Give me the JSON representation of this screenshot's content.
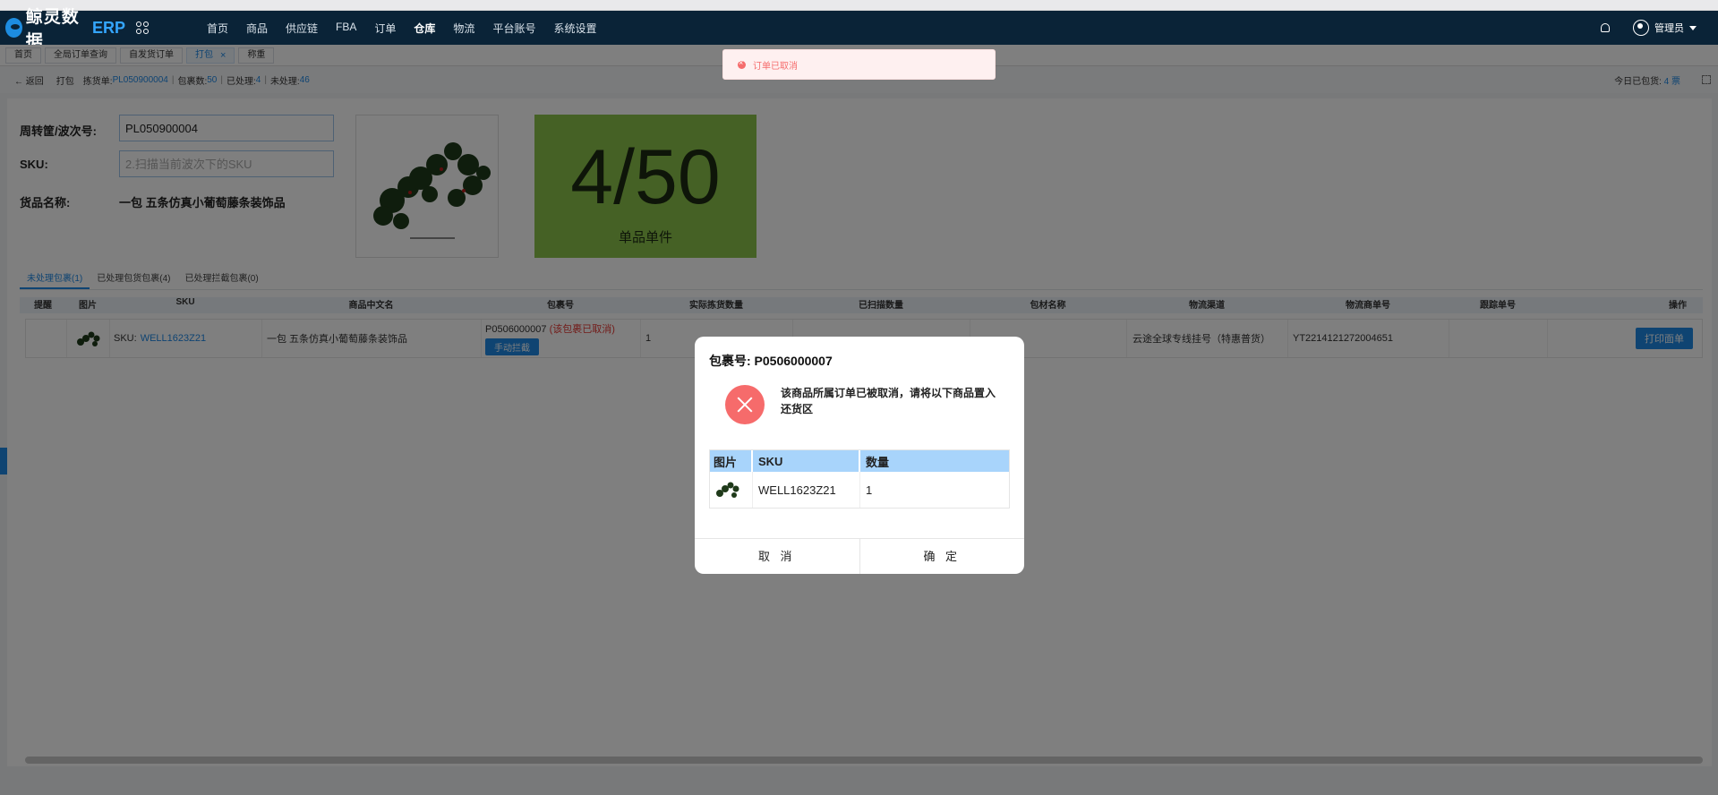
{
  "header": {
    "logo_text": "鲸灵数据",
    "logo_erp": "ERP",
    "nav": [
      "首页",
      "商品",
      "供应链",
      "FBA",
      "订单",
      "仓库",
      "物流",
      "平台账号",
      "系统设置"
    ],
    "active_nav": "仓库",
    "user": "管理员"
  },
  "tabs": [
    {
      "label": "首页"
    },
    {
      "label": "全局订单查询"
    },
    {
      "label": "自发货订单"
    },
    {
      "label": "打包",
      "close": "×"
    },
    {
      "label": "称重"
    }
  ],
  "subbar": {
    "back": "← 返回",
    "page": "打包",
    "pick_label": "拣货单:",
    "pick_value": "PL050900004",
    "pkg_label": "包裹数:",
    "pkg_value": "50",
    "done_label": "已处理:",
    "done_value": "4",
    "undone_label": "未处理:",
    "undone_value": "46",
    "today_label": "今日已包货:",
    "today_value": "4 票"
  },
  "form": {
    "wave_label": "周转筐/波次号:",
    "wave_value": "PL050900004",
    "sku_label": "SKU:",
    "sku_placeholder": "2.扫描当前波次下的SKU",
    "goods_label": "货品名称:",
    "goods_value": "一包 五条仿真小葡萄藤条装饰品"
  },
  "counter": {
    "value": "4/50",
    "label": "单品单件"
  },
  "subtabs": [
    "未处理包裹(1)",
    "已处理包货包裹(4)",
    "已处理拦截包裹(0)"
  ],
  "table": {
    "headers": [
      "提醒",
      "图片",
      "SKU",
      "商品中文名",
      "包裹号",
      "实际拣货数量",
      "已扫描数量",
      "包材名称",
      "物流渠道",
      "物流商单号",
      "跟踪单号",
      "操作"
    ],
    "row": {
      "sku_prefix": "SKU:",
      "sku": "WELL1623Z21",
      "name": "一包 五条仿真小葡萄藤条装饰品",
      "package": "P0506000007",
      "package_status": "(该包裹已取消)",
      "intercept_btn": "手动拦截",
      "picked": "1",
      "channel": "云途全球专线挂号（特惠普货）",
      "carrier_no": "YT2214121272004651",
      "print_btn": "打印面单"
    }
  },
  "toast": {
    "message": "订单已取消"
  },
  "modal": {
    "title": "包裹号: P0506000007",
    "message": "该商品所属订单已被取消，请将以下商品置入还货区",
    "headers": [
      "图片",
      "SKU",
      "数量"
    ],
    "row": {
      "sku": "WELL1623Z21",
      "qty": "1"
    },
    "cancel": "取 消",
    "confirm": "确 定"
  },
  "colors": {
    "topbar": "#0a2337",
    "accent": "#1e88e5",
    "counter_bg": "#8bc34a",
    "error": "#f66b6b"
  }
}
